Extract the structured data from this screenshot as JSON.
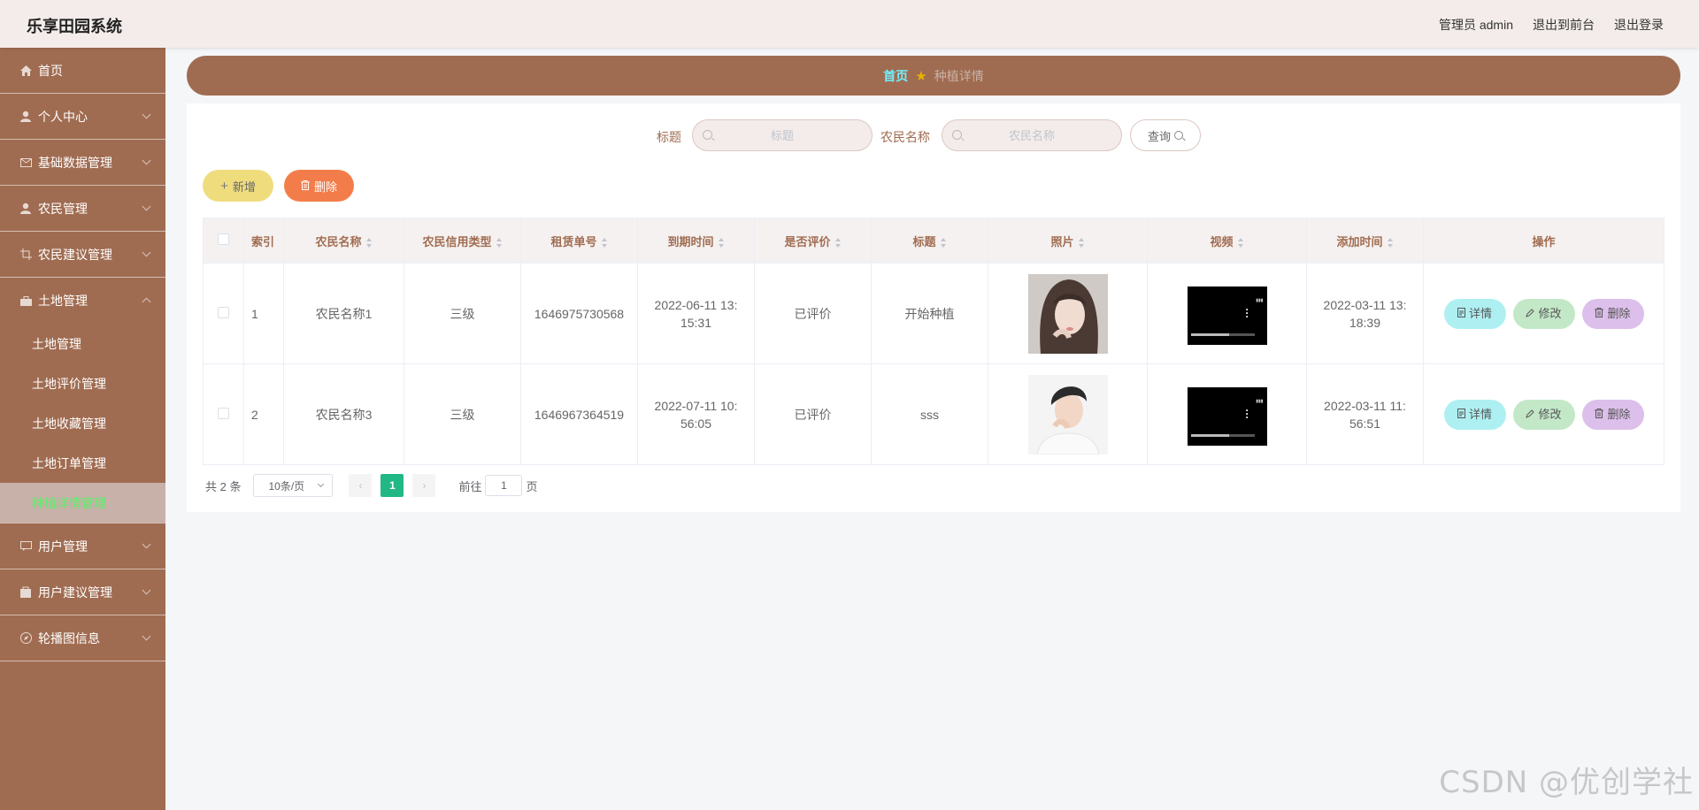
{
  "header": {
    "app_title": "乐享田园系统",
    "admin_label": "管理员 admin",
    "front_link": "退出到前台",
    "logout_link": "退出登录"
  },
  "sidebar": {
    "items": [
      {
        "label": "首页",
        "icon": "home-icon"
      },
      {
        "label": "个人中心",
        "icon": "user-icon"
      },
      {
        "label": "基础数据管理",
        "icon": "mail-icon"
      },
      {
        "label": "农民管理",
        "icon": "user-icon"
      },
      {
        "label": "农民建议管理",
        "icon": "crop-icon"
      },
      {
        "label": "土地管理",
        "icon": "suitcase-icon"
      },
      {
        "label": "用户管理",
        "icon": "chat-icon"
      },
      {
        "label": "用户建议管理",
        "icon": "bag-icon"
      },
      {
        "label": "轮播图信息",
        "icon": "compass-icon"
      }
    ],
    "land_sub": [
      "土地管理",
      "土地评价管理",
      "土地收藏管理",
      "土地订单管理",
      "种植详情管理"
    ]
  },
  "breadcrumb": {
    "home": "首页",
    "current": "种植详情"
  },
  "search": {
    "title_label": "标题",
    "title_placeholder": "标题",
    "farmer_label": "农民名称",
    "farmer_placeholder": "农民名称",
    "query_label": "查询"
  },
  "actions": {
    "add_label": "新增",
    "delete_label": "删除"
  },
  "table": {
    "headers": [
      "索引",
      "农民名称",
      "农民信用类型",
      "租赁单号",
      "到期时间",
      "是否评价",
      "标题",
      "照片",
      "视频",
      "添加时间",
      "操作"
    ],
    "rows": [
      {
        "index": "1",
        "farmer": "农民名称1",
        "credit": "三级",
        "order_no": "1646975730568",
        "expire": "2022-06-11 13:15:31",
        "evaluated": "已评价",
        "title": "开始种植",
        "added": "2022-03-11 13:18:39"
      },
      {
        "index": "2",
        "farmer": "农民名称3",
        "credit": "三级",
        "order_no": "1646967364519",
        "expire": "2022-07-11 10:56:05",
        "evaluated": "已评价",
        "title": "sss",
        "added": "2022-03-11 11:56:51"
      }
    ],
    "op_detail": "详情",
    "op_edit": "修改",
    "op_delete": "删除"
  },
  "pagination": {
    "total": "共 2 条",
    "page_size": "10条/页",
    "current_page": "1",
    "goto_label": "前往",
    "goto_value": "1",
    "page_unit": "页"
  },
  "watermark": "CSDN @优创学社",
  "colors": {
    "sidebar_bg": "#a06c51",
    "header_bg": "#f3ecea",
    "active_submenu_text": "#5cf06a",
    "pager_active": "#21b886"
  }
}
